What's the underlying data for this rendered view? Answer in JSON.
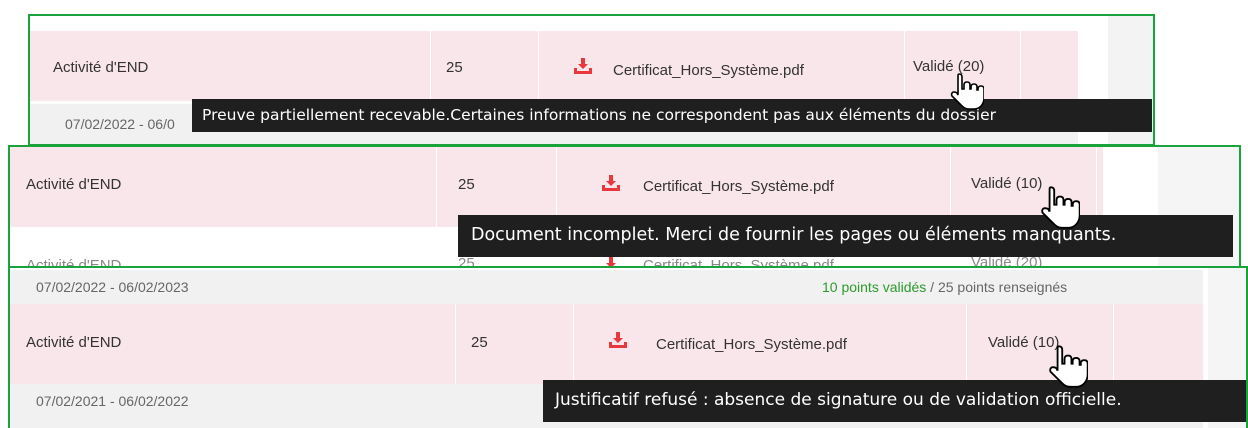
{
  "colors": {
    "frame_border": "#1aa33a",
    "row_pink": "#f9e6ea",
    "row_gray": "#f1f1f1",
    "tooltip_bg": "#1f1f1f",
    "download_icon": "#e8383d",
    "validated_green": "#2e9a2e"
  },
  "panel1": {
    "activity": "Activité d'END",
    "points": "25",
    "file": "Certificat_Hors_Système.pdf",
    "status": "Validé (20)",
    "period_partial": "07/02/2022 - 06/0",
    "tooltip": "Preuve partiellement recevable.Certaines informations ne correspondent pas aux éléments du dossier"
  },
  "panel2": {
    "activity": "Activité d'END",
    "points": "25",
    "file": "Certificat_Hors_Système.pdf",
    "status": "Validé (10)",
    "tooltip": "Document incomplet. Merci de fournir les pages ou éléments manquants.",
    "cut_activity": "Activité d'END",
    "cut_points": "25",
    "cut_file": "Certificat_Hors_Système.pdf",
    "cut_status": "Validé (20)"
  },
  "panel3": {
    "period_top": "07/02/2022 - 06/02/2023",
    "summary_validated": "10 points validés",
    "summary_rest": " / 25 points renseignés",
    "activity": "Activité d'END",
    "points": "25",
    "file": "Certificat_Hors_Système.pdf",
    "status": "Validé (10)",
    "period_bottom": "07/02/2021 - 06/02/2022",
    "tooltip": "Justificatif refusé : absence de signature ou de validation officielle."
  },
  "icons": {
    "download": "download-icon",
    "cursor": "hand-pointer-icon"
  }
}
